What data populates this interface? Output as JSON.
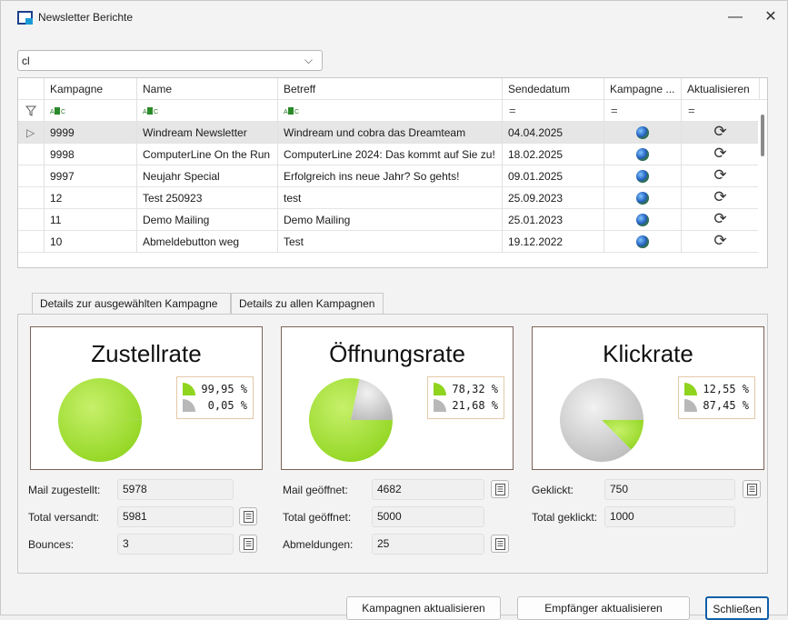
{
  "window": {
    "title": "Newsletter Berichte",
    "minimize": "—",
    "close": "✕"
  },
  "filter_combo": {
    "value": "cl",
    "arrow": "⌵"
  },
  "grid": {
    "columns": [
      "Kampagne",
      "Name",
      "Betreff",
      "Sendedatum",
      "Kampagne ...",
      "Aktualisieren"
    ],
    "filter_eq": "=",
    "rows": [
      {
        "kampagne": "9999",
        "name": "Windream Newsletter",
        "betreff": "Windream und cobra das Dreamteam",
        "datum": "04.04.2025",
        "selected": true
      },
      {
        "kampagne": "9998",
        "name": "ComputerLine On the Run",
        "betreff": "ComputerLine 2024: Das kommt auf Sie zu!",
        "datum": "18.02.2025"
      },
      {
        "kampagne": "9997",
        "name": "Neujahr Special",
        "betreff": "Erfolgreich ins neue Jahr? So gehts!",
        "datum": "09.01.2025"
      },
      {
        "kampagne": "12",
        "name": "Test 250923",
        "betreff": "test",
        "datum": "25.09.2023"
      },
      {
        "kampagne": "11",
        "name": "Demo Mailing",
        "betreff": "Demo Mailing",
        "datum": "25.01.2023"
      },
      {
        "kampagne": "10",
        "name": "Abmeldebutton weg",
        "betreff": "Test",
        "datum": "19.12.2022"
      }
    ],
    "refresh_glyph": "⟳",
    "row_indicator": "▷"
  },
  "tabs": [
    "Details zur ausgewählten Kampagne",
    "Details zu allen Kampagnen"
  ],
  "cards": [
    {
      "title": "Zustellrate",
      "legend": [
        "99,95 %",
        "0,05 %"
      ],
      "fraction": 0.9995
    },
    {
      "title": "Öffnungsrate",
      "legend": [
        "78,32 %",
        "21,68 %"
      ],
      "fraction": 0.7832
    },
    {
      "title": "Klickrate",
      "legend": [
        "12,55 %",
        "87,45 %"
      ],
      "fraction": 0.1255
    }
  ],
  "colors": {
    "green": "#8fd41e",
    "gray": "#b8b8b8",
    "accent": "#0f5ea8"
  },
  "stats": {
    "zugestellt_label": "Mail zugestellt:",
    "zugestellt": "5978",
    "versandt_label": "Total versandt:",
    "versandt": "5981",
    "bounces_label": "Bounces:",
    "bounces": "3",
    "geoeffnet_label": "Mail geöffnet:",
    "geoeffnet": "4682",
    "total_geoeffnet_label": "Total geöffnet:",
    "total_geoeffnet": "5000",
    "abmeldungen_label": "Abmeldungen:",
    "abmeldungen": "25",
    "geklickt_label": "Geklickt:",
    "geklickt": "750",
    "total_geklickt_label": "Total geklickt:",
    "total_geklickt": "1000"
  },
  "buttons": {
    "kampagnen": "Kampagnen aktualisieren",
    "empfaenger": "Empfänger aktualisieren",
    "schliessen": "Schließen"
  }
}
